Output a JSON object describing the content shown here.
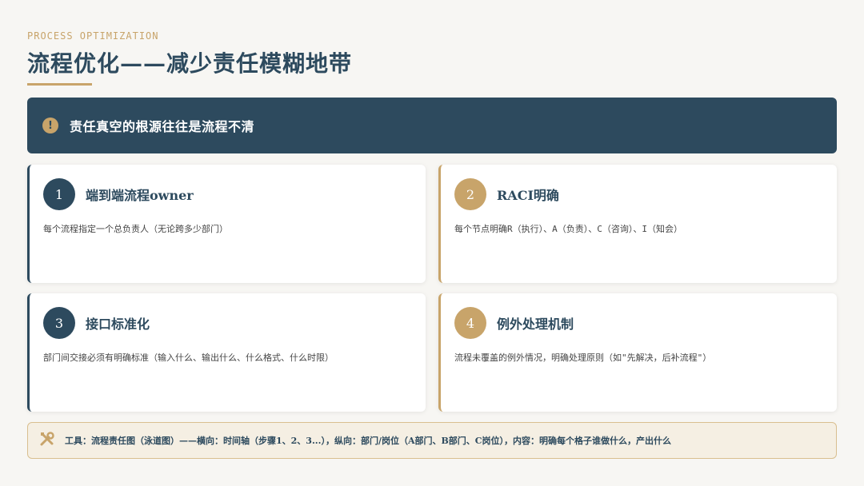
{
  "header": {
    "eyebrow": "PROCESS OPTIMIZATION",
    "title": "流程优化——减少责任模糊地带"
  },
  "banner": {
    "icon": "!",
    "text": "责任真空的根源往往是流程不清"
  },
  "cards": [
    {
      "num": "1",
      "title": "端到端流程owner",
      "desc": "每个流程指定一个总负责人（无论跨多少部门）"
    },
    {
      "num": "2",
      "title": "RACI明确",
      "desc": "每个节点明确R（执行）、A（负责）、C（咨询）、I（知会）"
    },
    {
      "num": "3",
      "title": "接口标准化",
      "desc": "部门间交接必须有明确标准（输入什么、输出什么、什么格式、什么时限）"
    },
    {
      "num": "4",
      "title": "例外处理机制",
      "desc": "流程未覆盖的例外情况，明确处理原则（如\"先解决，后补流程\"）"
    }
  ],
  "tool": {
    "icon": "tools-icon",
    "text": "工具：流程责任图（泳道图）——横向：时间轴（步骤1、2、3...），纵向：部门/岗位（A部门、B部门、C岗位），内容：明确每个格子谁做什么，产出什么"
  },
  "colors": {
    "navy": "#2d4a5e",
    "gold": "#c8a46a",
    "background": "#f7f6f3"
  }
}
